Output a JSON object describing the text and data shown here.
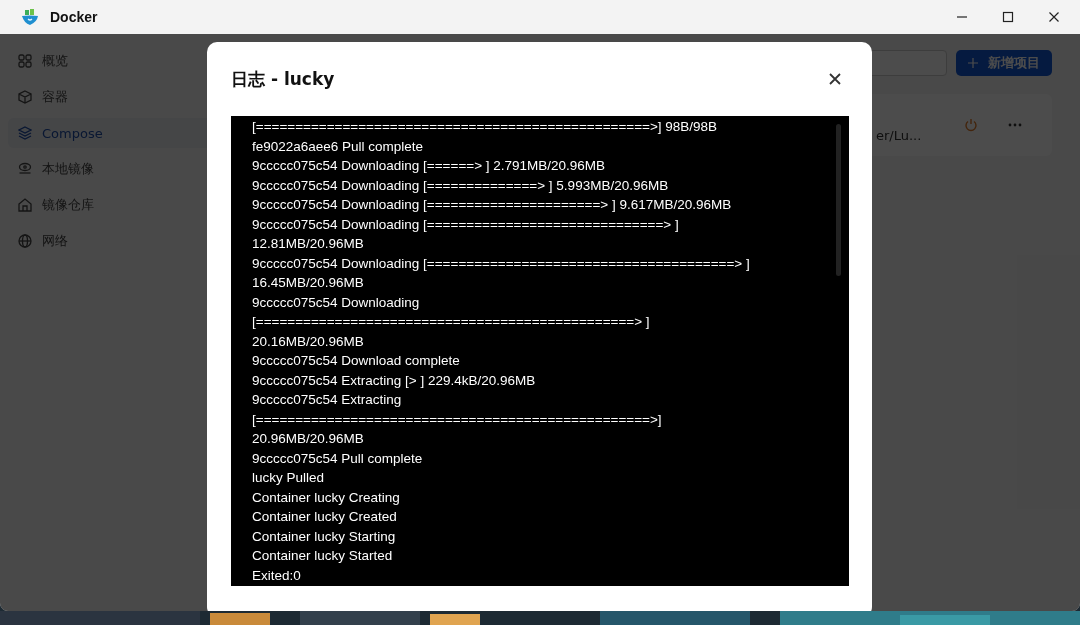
{
  "window": {
    "title": "Docker"
  },
  "sidebar": {
    "items": [
      {
        "label": "概览",
        "selected": false
      },
      {
        "label": "容器",
        "selected": false
      },
      {
        "label": "Compose",
        "selected": true
      },
      {
        "label": "本地镜像",
        "selected": false
      },
      {
        "label": "镜像仓库",
        "selected": false
      },
      {
        "label": "网络",
        "selected": false
      }
    ]
  },
  "toolbar": {
    "new_button": "新增项目"
  },
  "project_card": {
    "path": "er/Lu..."
  },
  "dialog": {
    "title": "日志 - lucky",
    "log_lines": [
      "[==================================================>] 98B/98B",
      "fe9022a6aee6 Pull complete",
      "9ccccc075c54 Downloading [======> ] 2.791MB/20.96MB",
      "9ccccc075c54 Downloading [==============> ] 5.993MB/20.96MB",
      "9ccccc075c54 Downloading [======================> ] 9.617MB/20.96MB",
      "9ccccc075c54 Downloading [==============================> ]",
      "12.81MB/20.96MB",
      "9ccccc075c54 Downloading [=======================================> ]",
      "16.45MB/20.96MB",
      "9ccccc075c54 Downloading",
      "[================================================> ]",
      "20.16MB/20.96MB",
      "9ccccc075c54 Download complete",
      "9ccccc075c54 Extracting [> ] 229.4kB/20.96MB",
      "9ccccc075c54 Extracting",
      "[==================================================>]",
      "20.96MB/20.96MB",
      "9ccccc075c54 Pull complete",
      "lucky Pulled",
      "Container lucky Creating",
      "Container lucky Created",
      "Container lucky Starting",
      "Container lucky Started",
      "Exited:0"
    ]
  }
}
